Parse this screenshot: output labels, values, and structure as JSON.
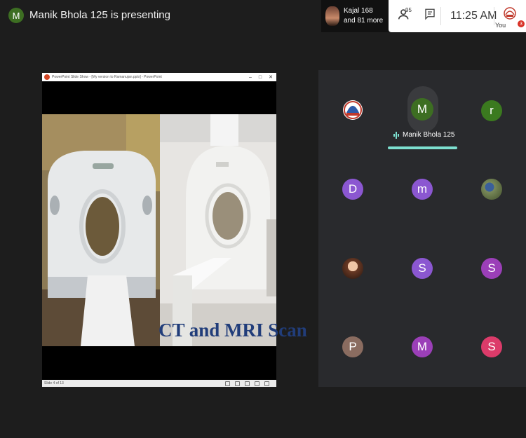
{
  "topbar": {
    "presenter_initial": "M",
    "presenting_text": "Manik Bhola 125 is presenting",
    "presenter_avatar_color": "#3d6e22"
  },
  "joiner": {
    "line1": "Kajal 168",
    "line2": "and 81 more"
  },
  "header_controls": {
    "people_count": "95",
    "time": "11:25 AM",
    "you_label": "You",
    "badge_count": "3",
    "icons": [
      "people-icon",
      "chat-icon",
      "account-logo-icon"
    ]
  },
  "presentation": {
    "window_title": "PowerPoint Slide Show - [My version to Ramanujan.pptx] - PowerPoint",
    "caption": "CT and MRI Scan",
    "status_text": "Slide 4 of 13"
  },
  "participants": {
    "presenter_name": "Manik Bhola 125",
    "accent_color": "#7de0d0",
    "tiles": [
      {
        "initial": "",
        "kind": "logo",
        "color": "#ffffff"
      },
      {
        "initial": "M",
        "kind": "presenter",
        "color": "#3d6e22"
      },
      {
        "initial": "r",
        "kind": "letter",
        "color": "#3b7a1f"
      },
      {
        "initial": "D",
        "kind": "letter",
        "color": "#8b57d1"
      },
      {
        "initial": "m",
        "kind": "letter",
        "color": "#8b57d1"
      },
      {
        "initial": "",
        "kind": "photo-outdoor",
        "color": "#6e7a5a"
      },
      {
        "initial": "",
        "kind": "photo-person",
        "color": "#a86b4f"
      },
      {
        "initial": "S",
        "kind": "letter",
        "color": "#8b57d1"
      },
      {
        "initial": "S",
        "kind": "letter",
        "color": "#9b3fb8"
      },
      {
        "initial": "P",
        "kind": "letter",
        "color": "#8a6c60"
      },
      {
        "initial": "M",
        "kind": "letter",
        "color": "#9b3fb8"
      },
      {
        "initial": "S",
        "kind": "letter",
        "color": "#dc3b6a"
      }
    ]
  }
}
